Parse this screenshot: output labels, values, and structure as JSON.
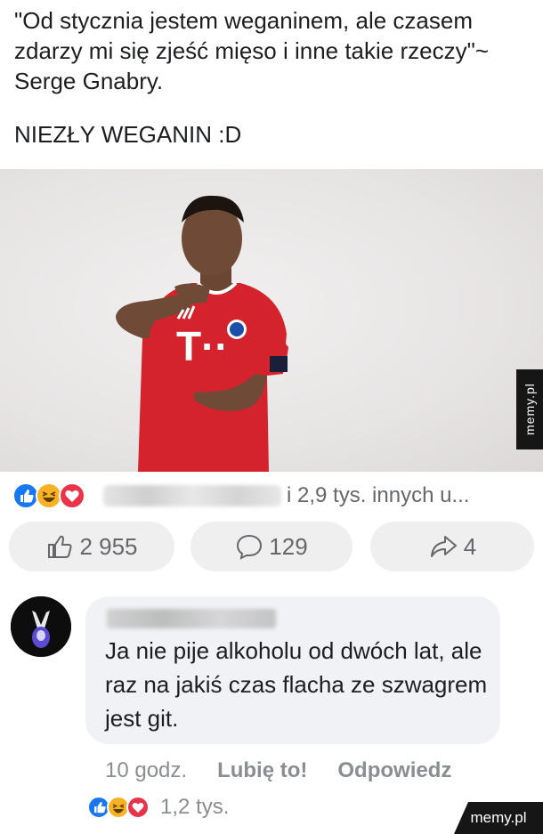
{
  "post": {
    "quote": "\"Od stycznia jestem weganinem, ale czasem zdarzy mi się zjeść mięso i inne takie rzeczy\"~ Serge Gnabry.",
    "caption": "NIEZŁY WEGANIN :D"
  },
  "photo": {
    "shirt_logo": "T··"
  },
  "reactions": {
    "icons": [
      "like-reaction",
      "haha-reaction",
      "love-reaction"
    ],
    "summary": "i 2,9 tys. innych u..."
  },
  "actions": {
    "likes": "2 955",
    "comments": "129",
    "shares": "4"
  },
  "comment": {
    "text": "Ja nie pije alkoholu od dwóch lat, ale raz na jakiś czas flacha ze szwagrem jest git.",
    "time": "10 godz.",
    "like_label": "Lubię to!",
    "reply_label": "Odpowiedz",
    "reaction_count": "1,2 tys."
  },
  "watermarks": {
    "side": "memy.pl",
    "corner": "memy.pl"
  },
  "colors": {
    "like_blue": "#1877f2",
    "haha_yellow": "#f7b125",
    "love_red": "#e9334b",
    "jersey_red": "#d4232c"
  }
}
